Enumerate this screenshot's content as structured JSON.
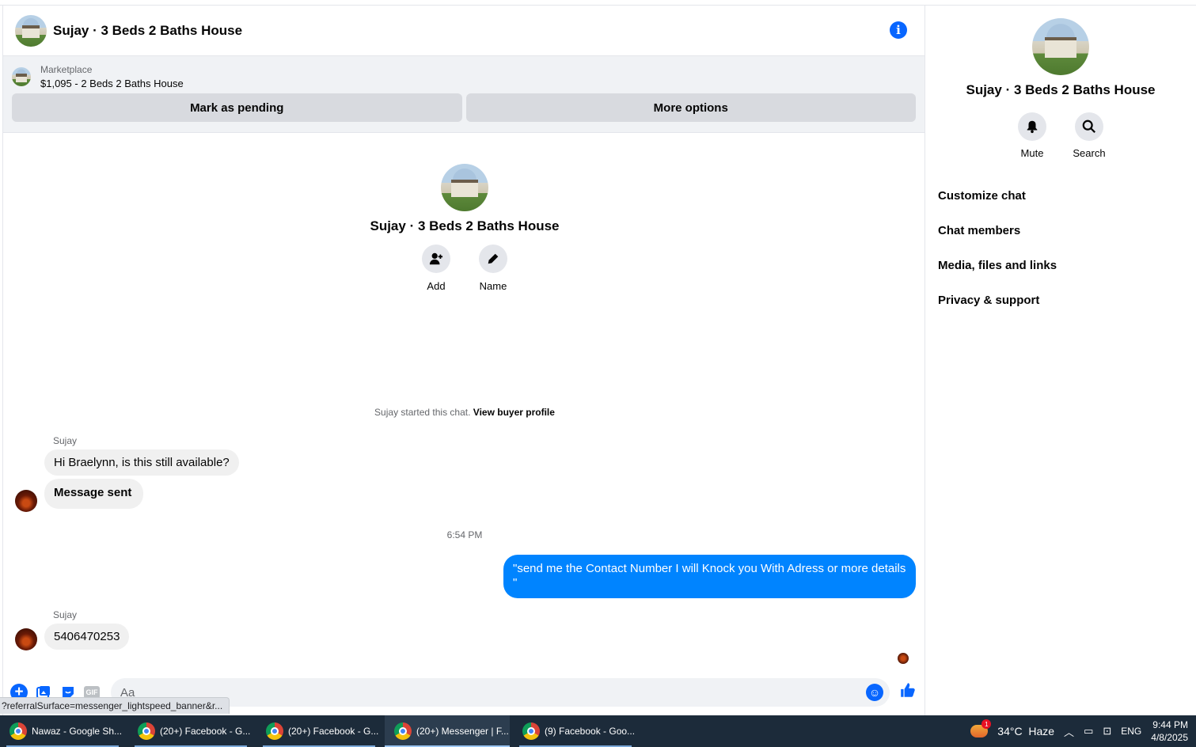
{
  "header": {
    "title": "Sujay · 3 Beds 2 Baths House"
  },
  "marketplace": {
    "label": "Marketplace",
    "listing": "$1,095 - 2 Beds 2 Baths House",
    "buttons": [
      "Mark as pending",
      "More options"
    ]
  },
  "intro": {
    "title": "Sujay · 3 Beds 2 Baths House",
    "actions": [
      {
        "label": "Add",
        "icon": "add-person-icon"
      },
      {
        "label": "Name",
        "icon": "pencil-icon"
      }
    ],
    "started_text": "Sujay started this chat.",
    "started_link": "View buyer profile"
  },
  "messages": {
    "group1_sender": "Sujay",
    "msg1": "Hi Braelynn, is this still available?",
    "msg2": "Message sent",
    "time": "6:54 PM",
    "outgoing": "\"send me the Contact Number I will Knock you With Adress or more details \"",
    "group2_sender": "Sujay",
    "msg3": "5406470253"
  },
  "composer": {
    "placeholder": "Aa",
    "gif_label": "GIF"
  },
  "status_url": "?referralSurface=messenger_lightspeed_banner&r...",
  "side": {
    "title": "Sujay · 3 Beds 2 Baths House",
    "actions": [
      {
        "label": "Mute",
        "icon": "bell-icon"
      },
      {
        "label": "Search",
        "icon": "search-icon"
      }
    ],
    "menu": [
      "Customize chat",
      "Chat members",
      "Media, files and links",
      "Privacy & support"
    ]
  },
  "taskbar": {
    "tasks": [
      "Nawaz - Google Sh...",
      "(20+) Facebook - G...",
      "(20+) Facebook - G...",
      "(20+) Messenger | F...",
      "(9) Facebook - Goo..."
    ],
    "weather_badge": "1",
    "weather": "34°C  Haze",
    "lang": "ENG",
    "time": "9:44 PM",
    "date": "4/8/2025"
  },
  "colors": {
    "accent": "#0866ff",
    "outgoing_bubble": "#0084ff",
    "incoming_bubble": "#f0f0f0"
  }
}
